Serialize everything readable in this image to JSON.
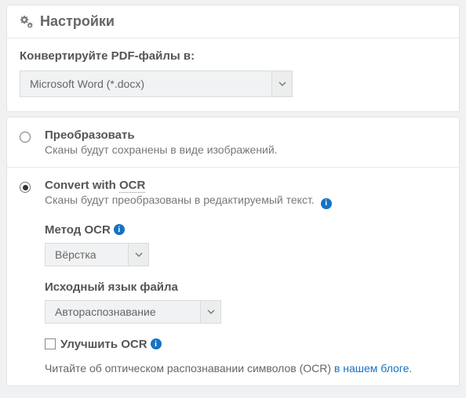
{
  "header": {
    "title": "Настройки"
  },
  "convert": {
    "label": "Конвертируйте PDF-файлы в:",
    "format_selected": "Microsoft Word (*.docx)"
  },
  "options": {
    "noOcr": {
      "title": "Преобразовать",
      "desc": "Сканы будут сохранены в виде изображений."
    },
    "withOcr": {
      "title_a": "Convert with ",
      "title_b": "OCR",
      "desc": "Сканы будут преобразованы в редактируемый текст.",
      "method_label": "Метод OCR",
      "method_selected": "Вёрстка",
      "lang_label": "Исходный язык файла",
      "lang_selected": "Автораспознавание",
      "enhance_label": "Улучшить OCR",
      "footer_a": "Читайте об оптическом распознавании символов (OCR) ",
      "footer_link": "в нашем блоге",
      "footer_b": "."
    }
  }
}
